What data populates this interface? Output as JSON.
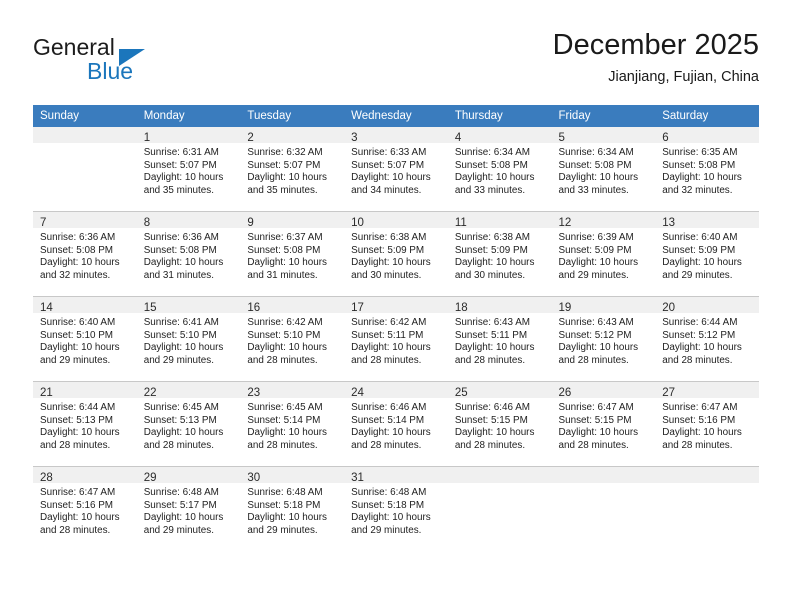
{
  "brand": {
    "word_top": "General",
    "word_bottom": "Blue",
    "accent_color": "#1b76bc",
    "triangle_icon": "triangle-icon"
  },
  "header": {
    "month_title": "December 2025",
    "location": "Jianjiang, Fujian, China"
  },
  "calendar": {
    "header_bg": "#3a7cbe",
    "daynum_bg": "#f0f0f0",
    "weekdays": [
      "Sunday",
      "Monday",
      "Tuesday",
      "Wednesday",
      "Thursday",
      "Friday",
      "Saturday"
    ],
    "weeks": [
      [
        {
          "day": "",
          "lines": []
        },
        {
          "day": "1",
          "lines": [
            "Sunrise: 6:31 AM",
            "Sunset: 5:07 PM",
            "Daylight: 10 hours",
            "and 35 minutes."
          ]
        },
        {
          "day": "2",
          "lines": [
            "Sunrise: 6:32 AM",
            "Sunset: 5:07 PM",
            "Daylight: 10 hours",
            "and 35 minutes."
          ]
        },
        {
          "day": "3",
          "lines": [
            "Sunrise: 6:33 AM",
            "Sunset: 5:07 PM",
            "Daylight: 10 hours",
            "and 34 minutes."
          ]
        },
        {
          "day": "4",
          "lines": [
            "Sunrise: 6:34 AM",
            "Sunset: 5:08 PM",
            "Daylight: 10 hours",
            "and 33 minutes."
          ]
        },
        {
          "day": "5",
          "lines": [
            "Sunrise: 6:34 AM",
            "Sunset: 5:08 PM",
            "Daylight: 10 hours",
            "and 33 minutes."
          ]
        },
        {
          "day": "6",
          "lines": [
            "Sunrise: 6:35 AM",
            "Sunset: 5:08 PM",
            "Daylight: 10 hours",
            "and 32 minutes."
          ]
        }
      ],
      [
        {
          "day": "7",
          "lines": [
            "Sunrise: 6:36 AM",
            "Sunset: 5:08 PM",
            "Daylight: 10 hours",
            "and 32 minutes."
          ]
        },
        {
          "day": "8",
          "lines": [
            "Sunrise: 6:36 AM",
            "Sunset: 5:08 PM",
            "Daylight: 10 hours",
            "and 31 minutes."
          ]
        },
        {
          "day": "9",
          "lines": [
            "Sunrise: 6:37 AM",
            "Sunset: 5:08 PM",
            "Daylight: 10 hours",
            "and 31 minutes."
          ]
        },
        {
          "day": "10",
          "lines": [
            "Sunrise: 6:38 AM",
            "Sunset: 5:09 PM",
            "Daylight: 10 hours",
            "and 30 minutes."
          ]
        },
        {
          "day": "11",
          "lines": [
            "Sunrise: 6:38 AM",
            "Sunset: 5:09 PM",
            "Daylight: 10 hours",
            "and 30 minutes."
          ]
        },
        {
          "day": "12",
          "lines": [
            "Sunrise: 6:39 AM",
            "Sunset: 5:09 PM",
            "Daylight: 10 hours",
            "and 29 minutes."
          ]
        },
        {
          "day": "13",
          "lines": [
            "Sunrise: 6:40 AM",
            "Sunset: 5:09 PM",
            "Daylight: 10 hours",
            "and 29 minutes."
          ]
        }
      ],
      [
        {
          "day": "14",
          "lines": [
            "Sunrise: 6:40 AM",
            "Sunset: 5:10 PM",
            "Daylight: 10 hours",
            "and 29 minutes."
          ]
        },
        {
          "day": "15",
          "lines": [
            "Sunrise: 6:41 AM",
            "Sunset: 5:10 PM",
            "Daylight: 10 hours",
            "and 29 minutes."
          ]
        },
        {
          "day": "16",
          "lines": [
            "Sunrise: 6:42 AM",
            "Sunset: 5:10 PM",
            "Daylight: 10 hours",
            "and 28 minutes."
          ]
        },
        {
          "day": "17",
          "lines": [
            "Sunrise: 6:42 AM",
            "Sunset: 5:11 PM",
            "Daylight: 10 hours",
            "and 28 minutes."
          ]
        },
        {
          "day": "18",
          "lines": [
            "Sunrise: 6:43 AM",
            "Sunset: 5:11 PM",
            "Daylight: 10 hours",
            "and 28 minutes."
          ]
        },
        {
          "day": "19",
          "lines": [
            "Sunrise: 6:43 AM",
            "Sunset: 5:12 PM",
            "Daylight: 10 hours",
            "and 28 minutes."
          ]
        },
        {
          "day": "20",
          "lines": [
            "Sunrise: 6:44 AM",
            "Sunset: 5:12 PM",
            "Daylight: 10 hours",
            "and 28 minutes."
          ]
        }
      ],
      [
        {
          "day": "21",
          "lines": [
            "Sunrise: 6:44 AM",
            "Sunset: 5:13 PM",
            "Daylight: 10 hours",
            "and 28 minutes."
          ]
        },
        {
          "day": "22",
          "lines": [
            "Sunrise: 6:45 AM",
            "Sunset: 5:13 PM",
            "Daylight: 10 hours",
            "and 28 minutes."
          ]
        },
        {
          "day": "23",
          "lines": [
            "Sunrise: 6:45 AM",
            "Sunset: 5:14 PM",
            "Daylight: 10 hours",
            "and 28 minutes."
          ]
        },
        {
          "day": "24",
          "lines": [
            "Sunrise: 6:46 AM",
            "Sunset: 5:14 PM",
            "Daylight: 10 hours",
            "and 28 minutes."
          ]
        },
        {
          "day": "25",
          "lines": [
            "Sunrise: 6:46 AM",
            "Sunset: 5:15 PM",
            "Daylight: 10 hours",
            "and 28 minutes."
          ]
        },
        {
          "day": "26",
          "lines": [
            "Sunrise: 6:47 AM",
            "Sunset: 5:15 PM",
            "Daylight: 10 hours",
            "and 28 minutes."
          ]
        },
        {
          "day": "27",
          "lines": [
            "Sunrise: 6:47 AM",
            "Sunset: 5:16 PM",
            "Daylight: 10 hours",
            "and 28 minutes."
          ]
        }
      ],
      [
        {
          "day": "28",
          "lines": [
            "Sunrise: 6:47 AM",
            "Sunset: 5:16 PM",
            "Daylight: 10 hours",
            "and 28 minutes."
          ]
        },
        {
          "day": "29",
          "lines": [
            "Sunrise: 6:48 AM",
            "Sunset: 5:17 PM",
            "Daylight: 10 hours",
            "and 29 minutes."
          ]
        },
        {
          "day": "30",
          "lines": [
            "Sunrise: 6:48 AM",
            "Sunset: 5:18 PM",
            "Daylight: 10 hours",
            "and 29 minutes."
          ]
        },
        {
          "day": "31",
          "lines": [
            "Sunrise: 6:48 AM",
            "Sunset: 5:18 PM",
            "Daylight: 10 hours",
            "and 29 minutes."
          ]
        },
        {
          "day": "",
          "lines": []
        },
        {
          "day": "",
          "lines": []
        },
        {
          "day": "",
          "lines": []
        }
      ]
    ]
  }
}
